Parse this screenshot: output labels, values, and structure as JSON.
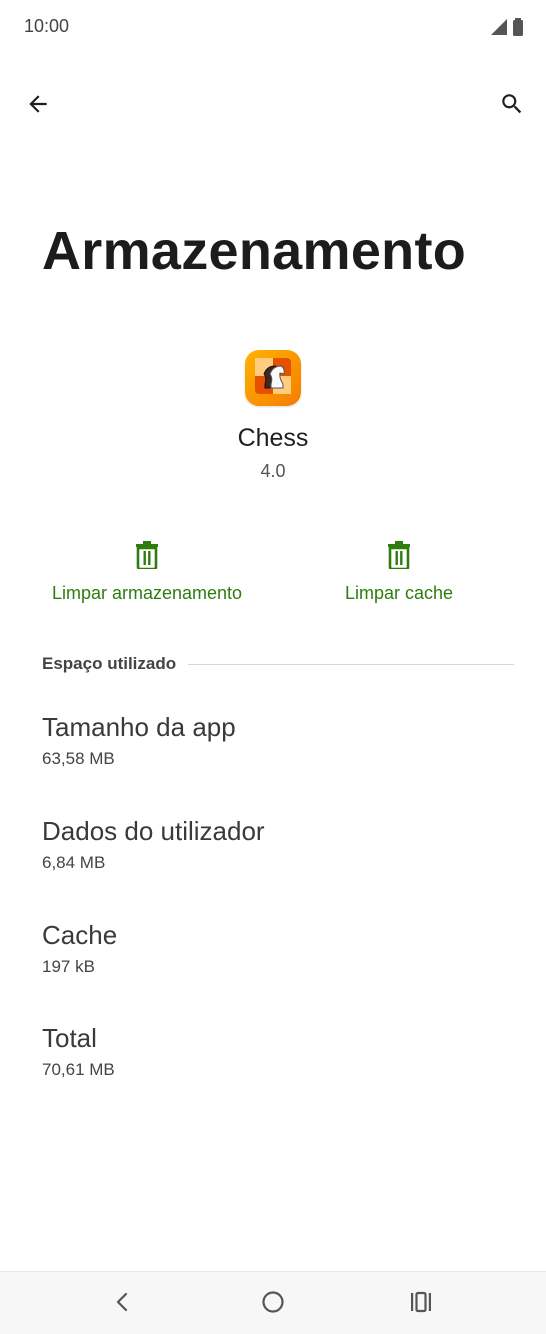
{
  "status_bar": {
    "time": "10:00",
    "icons": [
      "signal-icon",
      "battery-icon"
    ]
  },
  "toolbar": {
    "back_icon": "arrow-left-icon",
    "search_icon": "search-icon"
  },
  "page": {
    "title": "Armazenamento"
  },
  "app": {
    "icon": "chess-knight-icon",
    "name": "Chess",
    "version": "4.0"
  },
  "actions": {
    "clear_storage_label": "Limpar armazenamento",
    "clear_cache_label": "Limpar cache",
    "icon": "trash-icon",
    "color": "#2e7d0f"
  },
  "storage": {
    "section_title": "Espaço utilizado",
    "items": [
      {
        "label": "Tamanho da app",
        "value": "63,58 MB"
      },
      {
        "label": "Dados do utilizador",
        "value": "6,84 MB"
      },
      {
        "label": "Cache",
        "value": "197 kB"
      },
      {
        "label": "Total",
        "value": "70,61 MB"
      }
    ]
  },
  "nav_bar": {
    "back_icon": "chevron-left-icon",
    "home_icon": "circle-home-icon",
    "recents_icon": "recents-icon"
  }
}
